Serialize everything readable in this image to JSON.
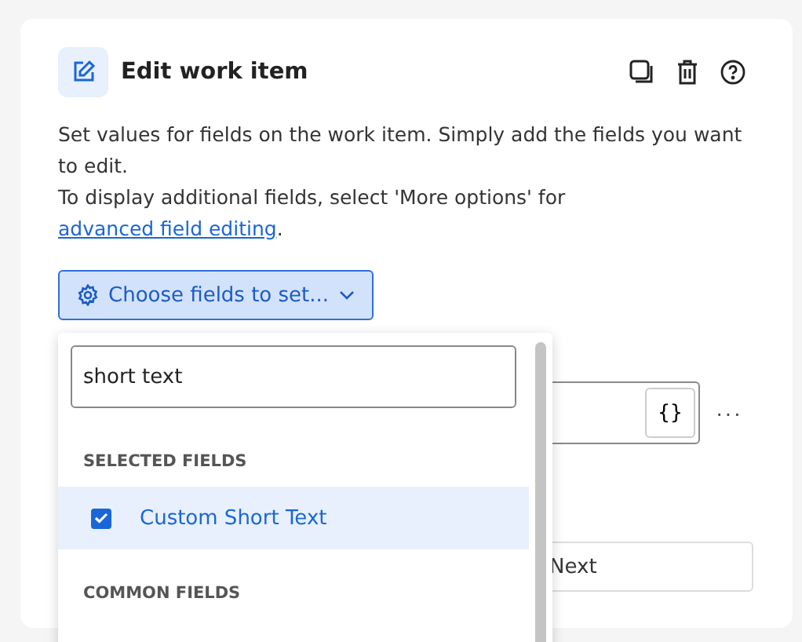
{
  "panel": {
    "title": "Edit work item",
    "description": "Set values for fields on the work item. Simply add the fields you want to edit.",
    "description_2": "To display additional fields, select 'More options' for ",
    "link": "advanced field editing",
    "description_end": "."
  },
  "choose_button": {
    "label": "Choose fields to set..."
  },
  "field_row": {
    "variable_button": "{}",
    "more": "···"
  },
  "next_button": {
    "label": "Next"
  },
  "dropdown": {
    "search": {
      "value": "short text"
    },
    "sections": [
      {
        "heading": "SELECTED FIELDS",
        "items": [
          {
            "label": "Custom Short Text",
            "checked": true,
            "selected": true
          }
        ]
      },
      {
        "heading": "COMMON FIELDS"
      }
    ]
  }
}
